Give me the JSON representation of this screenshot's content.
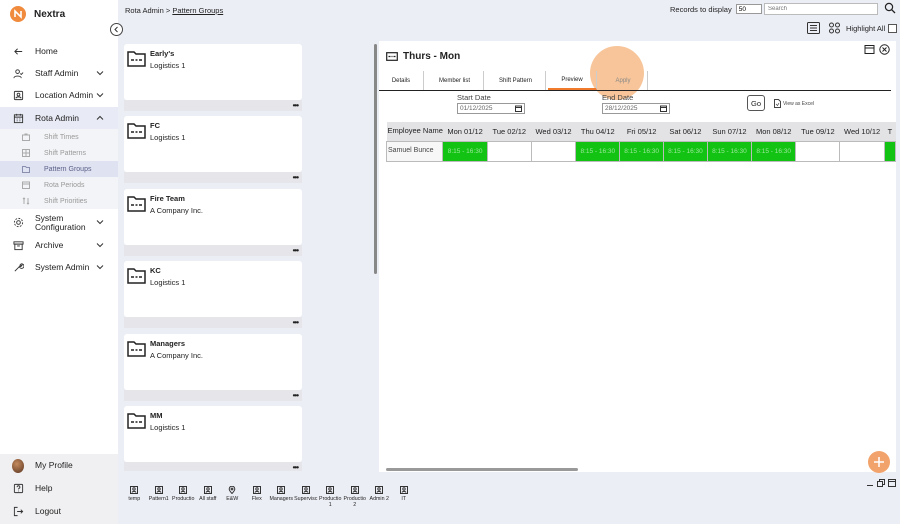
{
  "app": {
    "name": "Nextra",
    "brand_color": "#f08a3c"
  },
  "breadcrumb": {
    "parent": "Rota Admin",
    "separator": " > ",
    "current": "Pattern Groups"
  },
  "toolbar": {
    "records_label": "Records to display",
    "records_value": "50",
    "search_placeholder": "Search",
    "highlight_label": "Highlight All"
  },
  "nav": {
    "home": "Home",
    "staff_admin": "Staff Admin",
    "location_admin": "Location Admin",
    "rota_admin": "Rota Admin",
    "sub": [
      "Shift Times",
      "Shift Patterns",
      "Pattern Groups",
      "Rota Periods",
      "Shift Priorities"
    ],
    "system_configuration": "System Configuration",
    "archive": "Archive",
    "system_admin": "System Admin",
    "my_profile": "My Profile",
    "help": "Help",
    "logout": "Logout"
  },
  "groups": [
    {
      "name": "Early's",
      "org": "Logistics 1"
    },
    {
      "name": "FC",
      "org": "Logistics 1"
    },
    {
      "name": "Fire Team",
      "org": "A Company Inc."
    },
    {
      "name": "KC",
      "org": "Logistics 1"
    },
    {
      "name": "Managers",
      "org": "A Company Inc."
    },
    {
      "name": "MM",
      "org": "Logistics 1"
    }
  ],
  "more_label": "•••",
  "detail": {
    "title": "Thurs - Mon",
    "tabs": [
      "Details",
      "Member list",
      "Shift Pattern",
      "Preview",
      "Apply"
    ],
    "start_date_label": "Start Date",
    "start_date": "01/12/2025",
    "end_date_label": "End Date",
    "end_date": "28/12/2025",
    "go_label": "Go",
    "excel_label": "View as Excel",
    "table": {
      "employee_header": "Employee Name",
      "days": [
        "Mon 01/12",
        "Tue 02/12",
        "Wed 03/12",
        "Thu 04/12",
        "Fri 05/12",
        "Sat 06/12",
        "Sun 07/12",
        "Mon 08/12",
        "Tue 09/12",
        "Wed 10/12",
        "T"
      ],
      "employee": "Samuel Bunce",
      "shift_text": "8:15 - 16:30"
    },
    "shift_color": "#13c313"
  },
  "bottom_strip": [
    "temp",
    "Pattern1",
    "Productio",
    "All staff",
    "E&W",
    "Flex",
    "Managers",
    "Supervisc",
    "Productio 1",
    "Productio 2",
    "Admin 2",
    "IT"
  ]
}
